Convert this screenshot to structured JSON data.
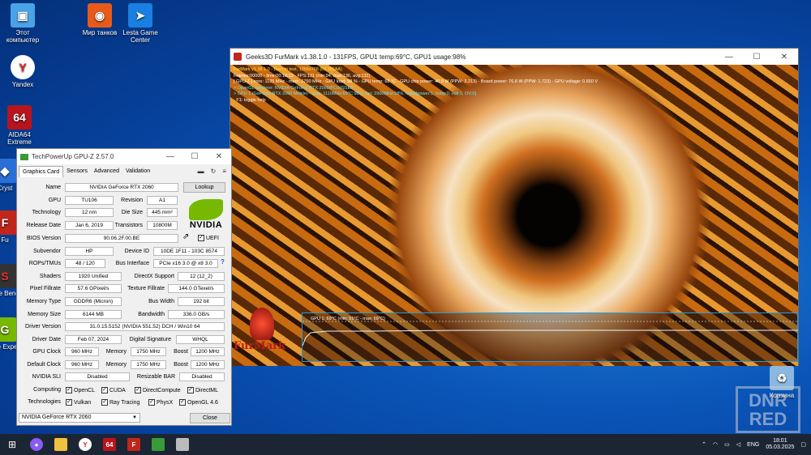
{
  "desktop": {
    "icons": [
      {
        "label": "Этот компьютер",
        "icon": "computer-icon",
        "color": "#4aa3e8"
      },
      {
        "label": "Yandex",
        "icon": "yandex-icon",
        "color": "#ffffff"
      },
      {
        "label": "AIDA64 Extreme",
        "icon": "aida64-icon",
        "color": "#b7141e"
      },
      {
        "label": "Cryst",
        "icon": "crystal-icon",
        "color": "#2a6fd6"
      },
      {
        "label": "Fu",
        "icon": "furmark-icon",
        "color": "#c0261c"
      },
      {
        "label": "Supe Bench",
        "icon": "superposition-icon",
        "color": "#333333"
      },
      {
        "label": "Ge Expe",
        "icon": "geforce-icon",
        "color": "#76b900"
      },
      {
        "label": "Мир танков",
        "icon": "tanks-icon",
        "color": "#e85a1a"
      },
      {
        "label": "Lesta Game Center",
        "icon": "lesta-icon",
        "color": "#1a7fe0"
      },
      {
        "label": "Корзина",
        "icon": "recycle-bin-icon",
        "color": "#8ab8e0"
      }
    ]
  },
  "furmark": {
    "title": "Geeks3D FurMark v1.38.1.0 - 131FPS, GPU1 temp:69°C, GPU1 usage:98%",
    "overlay": [
      {
        "text": "FurMark v1.38.1.0 - Burn-in test, 1366x768 (0X MSAA)",
        "color": "y"
      },
      {
        "text": "Frames:00000 - time:00:10:13 - FPS:131 (min:94, max:136, avg:132)",
        "color": "w"
      },
      {
        "text": "[ GPU-Z ] core: 1125 MHz - mem: 1750 MHz - GPU load: 98 % - GPU temp: 68 °C - GPU chip power: 40.0 W (PPW: 3.213) - Board power: 76.8 W (PPW: 1.723) - GPU voltage: 0.650 V",
        "color": "w"
      },
      {
        "text": "> OpenGL renderer: NVIDIA GeForce RTX 2060/PCIe/SSE2",
        "color": "c"
      },
      {
        "text": "> GPU 1 (GeForce RTX 2060 Mobile) - core: 1110MHz:69°C:98%, fan: 2960MHz:18%, limits[power:1, temp:0, volt:0, OV:0]",
        "color": "c"
      },
      {
        "text": "- F1: toggle help",
        "color": "w"
      }
    ],
    "graph_label": "GPU 1: 69°C (min: 51°C - max: 69°C)",
    "logo_text": "FurMark"
  },
  "gpuz": {
    "title": "TechPowerUp GPU-Z 2.57.0",
    "tabs": [
      "Graphics Card",
      "Sensors",
      "Advanced",
      "Validation"
    ],
    "name": "NVIDIA GeForce RTX 2060",
    "lookup": "Lookup",
    "gpu": "TU106",
    "revision": "A1",
    "technology": "12 nm",
    "die_size": "445 mm²",
    "release_date": "Jan 6, 2019",
    "transistors": "10800M",
    "bios_version": "90.06.2F.00.BE",
    "uefi": "UEFI",
    "subvendor": "HP",
    "device_id": "10DE 1F11 - 103C 8574",
    "rops_tmus": "48 / 120",
    "bus_interface": "PCIe x16 3.0 @ x8 3.0",
    "shaders": "1920 Unified",
    "directx": "12 (12_2)",
    "pixel_fillrate": "57.6 GPixel/s",
    "texture_fillrate": "144.0 GTexel/s",
    "memory_type": "GDDR6 (Micron)",
    "bus_width": "192 bit",
    "memory_size": "6144 MB",
    "bandwidth": "336.0 GB/s",
    "driver_version": "31.0.15.5152 (NVIDIA 551.52) DCH / Win10 64",
    "driver_date": "Feb 07, 2024",
    "digital_signature": "WHQL",
    "gpu_clock": "960 MHz",
    "memory_clock": "1750 MHz",
    "boost": "1200 MHz",
    "default_clock": "960 MHz",
    "default_memory": "1750 MHz",
    "default_boost": "1200 MHz",
    "sli": "Disabled",
    "resizable_bar": "Disabled",
    "labels": {
      "name": "Name",
      "gpu": "GPU",
      "revision": "Revision",
      "technology": "Technology",
      "die_size": "Die Size",
      "release_date": "Release Date",
      "transistors": "Transistors",
      "bios_version": "BIOS Version",
      "subvendor": "Subvendor",
      "device_id": "Device ID",
      "rops_tmus": "ROPs/TMUs",
      "bus_interface": "Bus Interface",
      "shaders": "Shaders",
      "directx": "DirectX Support",
      "pixel_fillrate": "Pixel Fillrate",
      "texture_fillrate": "Texture Fillrate",
      "memory_type": "Memory Type",
      "bus_width": "Bus Width",
      "memory_size": "Memory Size",
      "bandwidth": "Bandwidth",
      "driver_version": "Driver Version",
      "driver_date": "Driver Date",
      "digital_signature": "Digital Signature",
      "gpu_clock": "GPU Clock",
      "memory": "Memory",
      "boost": "Boost",
      "default_clock": "Default Clock",
      "sli": "NVIDIA SLI",
      "resizable_bar": "Resizable BAR",
      "computing": "Computing",
      "technologies": "Technologies"
    },
    "computing": [
      "OpenCL",
      "CUDA",
      "DirectCompute",
      "DirectML"
    ],
    "technologies": [
      "Vulkan",
      "Ray Tracing",
      "PhysX",
      "OpenGL 4.6"
    ],
    "selected_gpu": "NVIDIA GeForce RTX 2060",
    "close": "Close",
    "nvidia_word": "NVIDIA"
  },
  "taskbar": {
    "lang": "ENG",
    "time": "18:01",
    "date": "05.03.2025"
  },
  "watermark": {
    "line1": "DNR",
    "line2": "RED"
  }
}
